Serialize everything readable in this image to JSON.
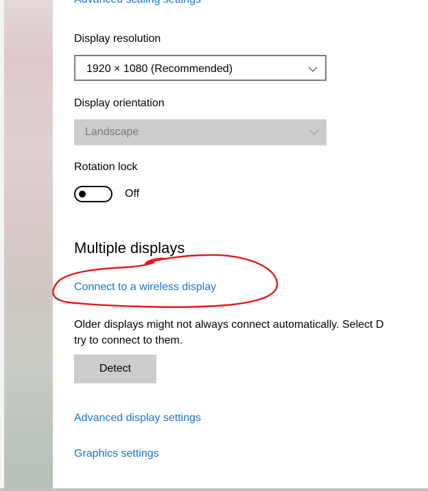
{
  "top_link_partial": "Advanced scaling settings",
  "resolution": {
    "label": "Display resolution",
    "value": "1920 × 1080 (Recommended)"
  },
  "orientation": {
    "label": "Display orientation",
    "value": "Landscape"
  },
  "rotation_lock": {
    "label": "Rotation lock",
    "state": "Off"
  },
  "multiple_displays": {
    "heading": "Multiple displays",
    "wireless_link": "Connect to a wireless display",
    "description_line1": "Older displays might not always connect automatically. Select D",
    "description_line2": "try to connect to them.",
    "detect_button": "Detect"
  },
  "links": {
    "advanced_display": "Advanced display settings",
    "graphics": "Graphics settings"
  },
  "colors": {
    "link": "#1a73c8",
    "annotation": "#e8151b",
    "disabled_fill": "#cccccc"
  }
}
